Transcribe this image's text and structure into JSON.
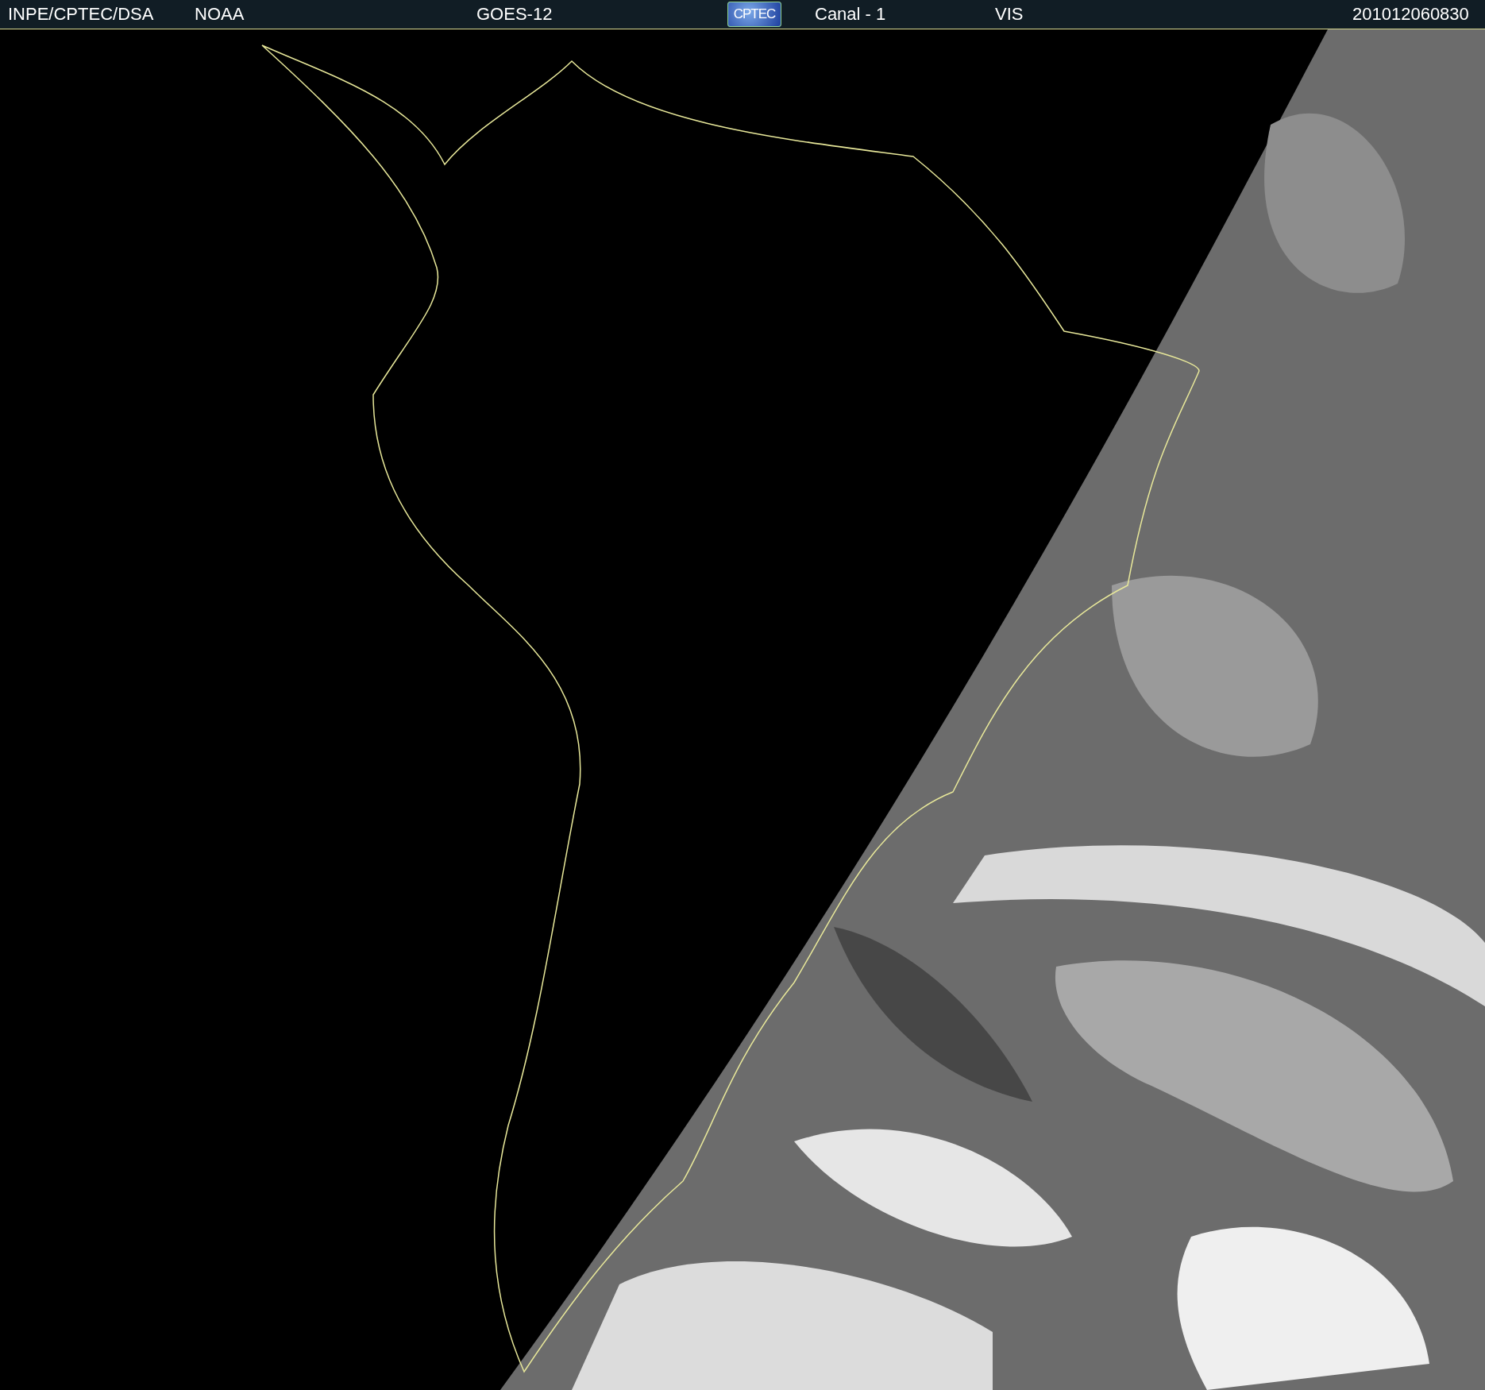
{
  "header": {
    "items": [
      {
        "kind": "text",
        "text": "INPE/CPTEC/DSA"
      },
      {
        "kind": "text",
        "text": "NOAA"
      },
      {
        "kind": "text",
        "text": "GOES-12"
      },
      {
        "kind": "logo",
        "text": "CPTEC"
      },
      {
        "kind": "text",
        "text": "Canal - 1"
      },
      {
        "kind": "text",
        "text": "VIS"
      },
      {
        "kind": "text",
        "text": "201012060830"
      }
    ]
  }
}
